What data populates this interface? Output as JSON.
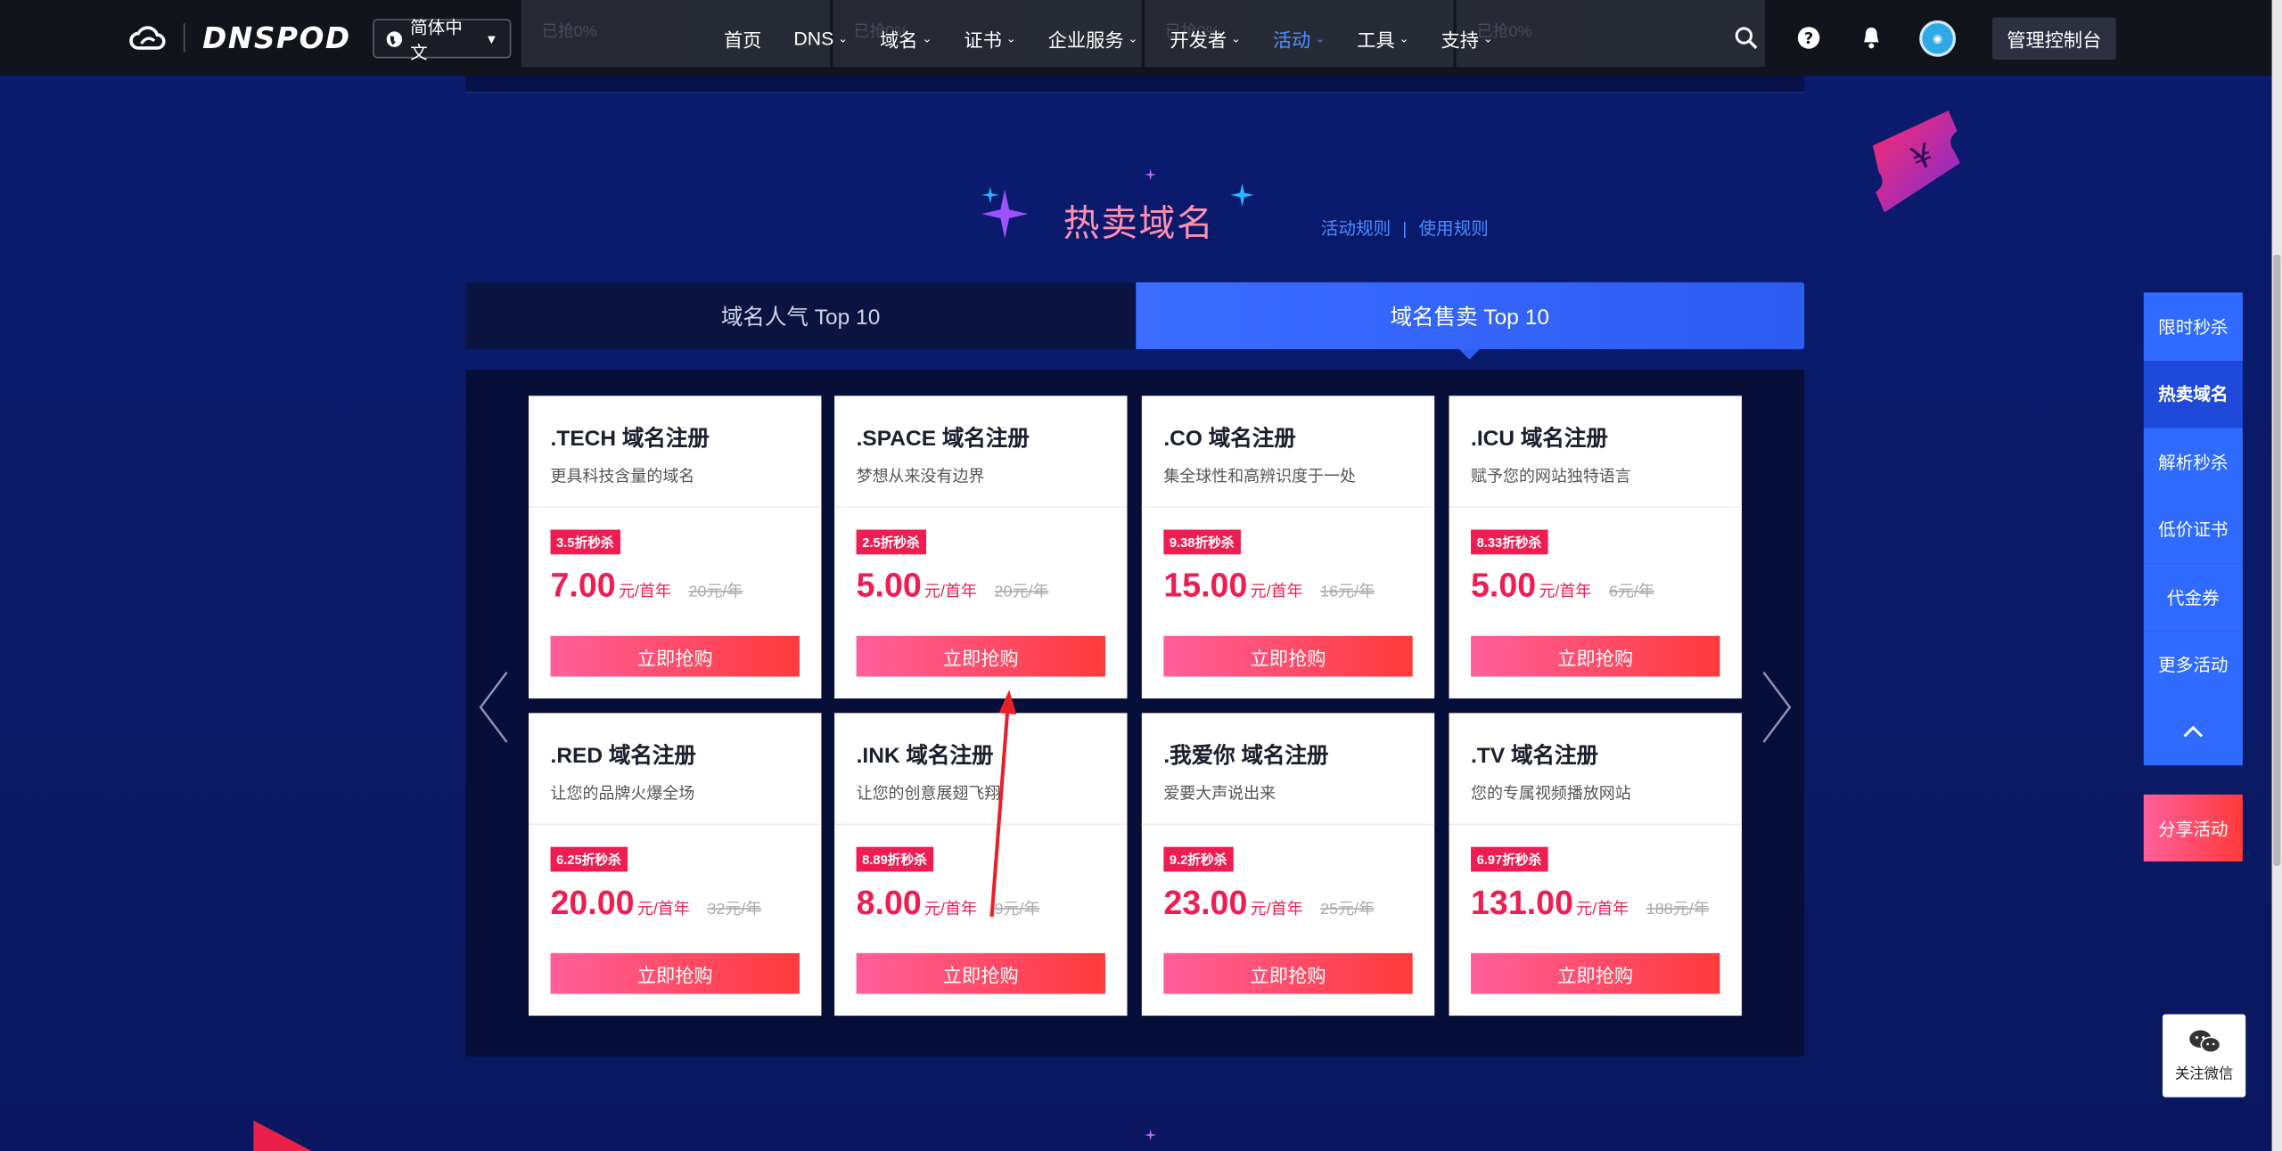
{
  "brand": {
    "logo_text": "DNSPOD"
  },
  "language": {
    "label": "简体中文"
  },
  "ghost_tabs": [
    "已抢0%",
    "已抢0%",
    "已抢0%",
    "已抢0%"
  ],
  "nav": {
    "items": [
      {
        "label": "首页",
        "has_caret": false
      },
      {
        "label": "DNS",
        "has_caret": true
      },
      {
        "label": "域名",
        "has_caret": true
      },
      {
        "label": "证书",
        "has_caret": true
      },
      {
        "label": "企业服务",
        "has_caret": true
      },
      {
        "label": "开发者",
        "has_caret": true
      },
      {
        "label": "活动",
        "has_caret": true,
        "active": true
      },
      {
        "label": "工具",
        "has_caret": true
      },
      {
        "label": "支持",
        "has_caret": true
      }
    ],
    "console_label": "管理控制台",
    "icons": [
      "search-icon",
      "help-icon",
      "bell-icon"
    ]
  },
  "section": {
    "title": "热卖域名",
    "rules_label": "活动规则",
    "usage_label": "使用规则",
    "title_color": "#ff8fb1",
    "link_color": "#4b8cff"
  },
  "tabs": [
    {
      "label": "域名人气 Top 10",
      "active": false
    },
    {
      "label": "域名售卖 Top 10",
      "active": true
    }
  ],
  "cards": [
    {
      "name": ".TECH 域名注册",
      "desc": "更具科技含量的域名",
      "badge": "3.5折秒杀",
      "price": "7.00",
      "unit": "元/首年",
      "orig": "20元/年",
      "buy": "立即抢购"
    },
    {
      "name": ".SPACE 域名注册",
      "desc": "梦想从来没有边界",
      "badge": "2.5折秒杀",
      "price": "5.00",
      "unit": "元/首年",
      "orig": "20元/年",
      "buy": "立即抢购"
    },
    {
      "name": ".CO 域名注册",
      "desc": "集全球性和高辨识度于一处",
      "badge": "9.38折秒杀",
      "price": "15.00",
      "unit": "元/首年",
      "orig": "16元/年",
      "buy": "立即抢购"
    },
    {
      "name": ".ICU 域名注册",
      "desc": "赋予您的网站独特语言",
      "badge": "8.33折秒杀",
      "price": "5.00",
      "unit": "元/首年",
      "orig": "6元/年",
      "buy": "立即抢购"
    },
    {
      "name": ".RED 域名注册",
      "desc": "让您的品牌火爆全场",
      "badge": "6.25折秒杀",
      "price": "20.00",
      "unit": "元/首年",
      "orig": "32元/年",
      "buy": "立即抢购"
    },
    {
      "name": ".INK 域名注册",
      "desc": "让您的创意展翅飞翔",
      "badge": "8.89折秒杀",
      "price": "8.00",
      "unit": "元/首年",
      "orig": "9元/年",
      "buy": "立即抢购"
    },
    {
      "name": ".我爱你 域名注册",
      "desc": "爱要大声说出来",
      "badge": "9.2折秒杀",
      "price": "23.00",
      "unit": "元/首年",
      "orig": "25元/年",
      "buy": "立即抢购"
    },
    {
      "name": ".TV 域名注册",
      "desc": "您的专属视频播放网站",
      "badge": "6.97折秒杀",
      "price": "131.00",
      "unit": "元/首年",
      "orig": "188元/年",
      "buy": "立即抢购"
    }
  ],
  "sidenav": {
    "items": [
      "限时秒杀",
      "热卖域名",
      "解析秒杀",
      "低价证书",
      "代金券",
      "更多活动"
    ],
    "current": "热卖域名",
    "share_label": "分享活动",
    "wechat_label": "关注微信"
  },
  "coupon_symbol": "¥",
  "colors": {
    "accent_blue": "#2f6bff",
    "price_red": "#ee1d52",
    "background": "#0a1a66"
  }
}
